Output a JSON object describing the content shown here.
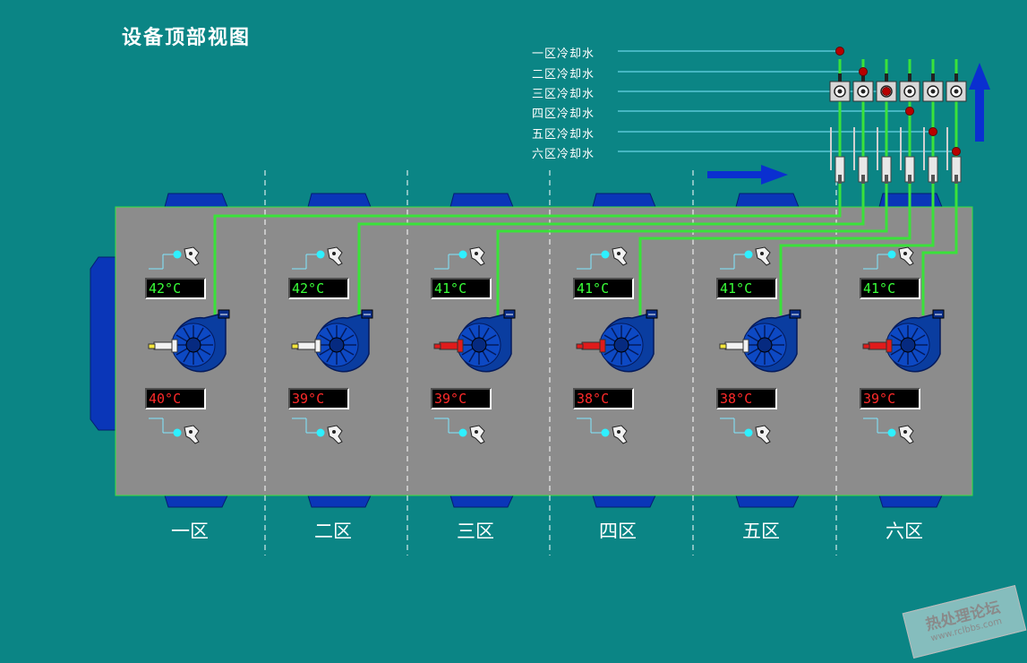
{
  "title": "设备顶部视图",
  "coolant_lines": [
    "一区冷却水",
    "二区冷却水",
    "三区冷却水",
    "四区冷却水",
    "五区冷却水",
    "六区冷却水"
  ],
  "zones": [
    {
      "name": "一区",
      "temp_top": "42°C",
      "temp_bottom": "40°C",
      "nozzle": "yellow"
    },
    {
      "name": "二区",
      "temp_top": "42°C",
      "temp_bottom": "39°C",
      "nozzle": "yellow"
    },
    {
      "name": "三区",
      "temp_top": "41°C",
      "temp_bottom": "39°C",
      "nozzle": "red"
    },
    {
      "name": "四区",
      "temp_top": "41°C",
      "temp_bottom": "38°C",
      "nozzle": "red"
    },
    {
      "name": "五区",
      "temp_top": "41°C",
      "temp_bottom": "38°C",
      "nozzle": "yellow"
    },
    {
      "name": "六区",
      "temp_top": "41°C",
      "temp_bottom": "39°C",
      "nozzle": "red"
    }
  ],
  "colors": {
    "background": "#0b8585",
    "furnace": "#8c8c8c",
    "pipe": "#3ae23a",
    "blower": "#0a3da0",
    "arrow": "#0a2fd0",
    "valve_dot": "#b80000"
  },
  "watermark": {
    "line1": "热处理论坛",
    "line2": "www.rclbbs.com"
  }
}
